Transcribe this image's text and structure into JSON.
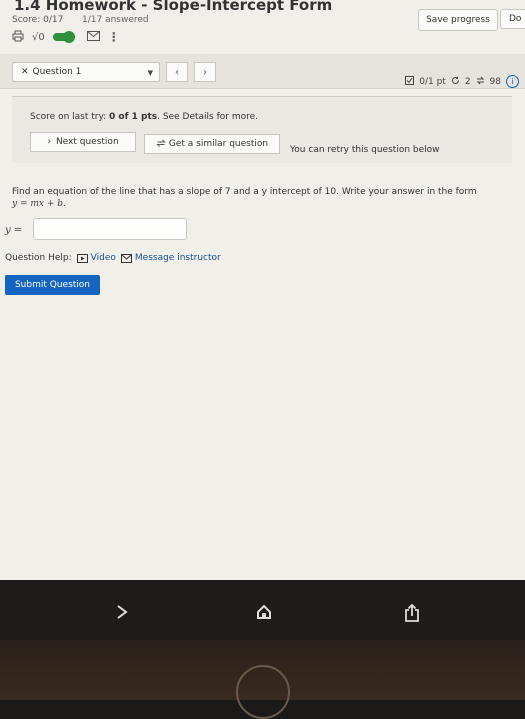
{
  "header": {
    "title": "1.4 Homework - Slope-Intercept Form",
    "score": "Score: 0/17",
    "answered": "1/17 answered",
    "sqrt_label": "√0",
    "more_label": "⋮",
    "save_label": "Save progress",
    "done_label": "Do"
  },
  "question_bar": {
    "select_value": "Question 1",
    "points": "0/1 pt",
    "retries": "2",
    "attempts": "98"
  },
  "notice": {
    "prefix": "Score on last try: ",
    "score": "0 of 1 pts",
    "suffix": ". See Details for more.",
    "next_label": "Next question",
    "similar_label": "Get a similar question",
    "retry_text": "You can retry this question below"
  },
  "question": {
    "prompt": "Find an equation of the line that has a slope of 7 and a y intercept of 10. Write your answer in the form",
    "form": "y = mx + b.",
    "answer_label": "y =",
    "answer_value": ""
  },
  "help": {
    "label": "Question Help:",
    "video_label": "Video",
    "message_label": "Message instructor"
  },
  "submit_label": "Submit Question"
}
